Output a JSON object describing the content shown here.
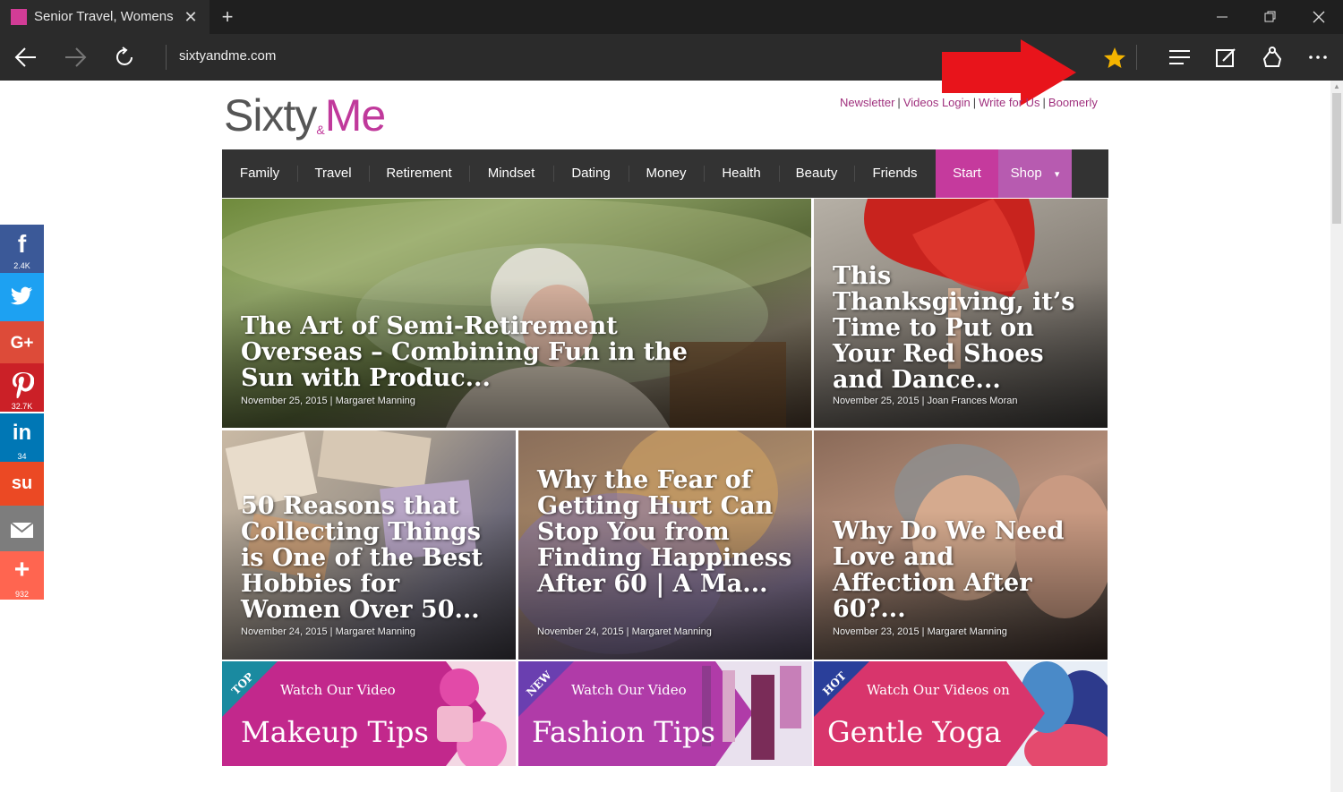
{
  "browser": {
    "tab_title": "Senior Travel, Womens I",
    "close_glyph": "✕",
    "new_tab_glyph": "+",
    "url": "sixtyandme.com"
  },
  "site": {
    "logo_sixty": "Sixty",
    "logo_amp": "&",
    "logo_me": "Me",
    "brand_color": "#c0399b",
    "toplinks": [
      "Newsletter",
      "Videos Login",
      "Write for Us",
      "Boomerly"
    ],
    "toplink_separator": "|"
  },
  "nav": {
    "items": [
      "Family",
      "Travel",
      "Retirement",
      "Mindset",
      "Dating",
      "Money",
      "Health",
      "Beauty",
      "Friends"
    ],
    "start": "Start",
    "shop": "Shop",
    "shop_caret": "▾"
  },
  "social": [
    {
      "icon": "facebook-icon",
      "glyph": "f",
      "count": "2.4K",
      "color": "#3b5998"
    },
    {
      "icon": "twitter-icon",
      "glyph": "🐦",
      "count": "",
      "color": "#1da1f2"
    },
    {
      "icon": "google-plus-icon",
      "glyph": "G+",
      "count": "",
      "color": "#dd4b39"
    },
    {
      "icon": "pinterest-icon",
      "glyph": "P",
      "count": "32.7K",
      "color": "#cb2027"
    },
    {
      "icon": "linkedin-icon",
      "glyph": "in",
      "count": "34",
      "color": "#0077b5"
    },
    {
      "icon": "stumbleupon-icon",
      "glyph": "su",
      "count": "",
      "color": "#eb4924"
    },
    {
      "icon": "email-icon",
      "glyph": "✉",
      "count": "",
      "color": "#7d7d7d"
    },
    {
      "icon": "share-plus-icon",
      "glyph": "+",
      "count": "932",
      "color": "#ff6550"
    }
  ],
  "articles": [
    {
      "title": "The Art of Semi-Retirement Overseas – Combining Fun in the Sun with Produc...",
      "date": "November 25, 2015",
      "author": "Margaret Manning",
      "meta": "November 25, 2015 | Margaret Manning"
    },
    {
      "title": "This Thanksgiving, it’s Time to Put on Your Red Shoes and Dance...",
      "date": "November 25, 2015",
      "author": "Joan Frances Moran",
      "meta": "November 25, 2015 | Joan Frances Moran"
    },
    {
      "title": "50 Reasons that Collecting Things is One of the Best Hobbies for Women Over 50...",
      "date": "November 24, 2015",
      "author": "Margaret Manning",
      "meta": "November 24, 2015 | Margaret Manning"
    },
    {
      "title": "Why the Fear of Getting Hurt Can Stop You from Finding Happiness After 60 | A Ma...",
      "date": "November 24, 2015",
      "author": "Margaret Manning",
      "meta": "November 24, 2015 | Margaret Manning"
    },
    {
      "title": "Why Do We Need Love and Affection After 60?...",
      "date": "November 23, 2015",
      "author": "Margaret Manning",
      "meta": "November 23, 2015 | Margaret Manning"
    }
  ],
  "promos": [
    {
      "badge": "TOP",
      "watch": "Watch Our Video",
      "title": "Makeup Tips",
      "color": "#c2288c",
      "badge_color": "#1a8aa0"
    },
    {
      "badge": "NEW",
      "watch": "Watch Our Video",
      "title": "Fashion Tips",
      "color": "#b03ba8",
      "badge_color": "#6a3fb0"
    },
    {
      "badge": "HOT",
      "watch": "Watch Our Videos on",
      "title": "Gentle Yoga",
      "color": "#d8356c",
      "badge_color": "#2a3f9a"
    }
  ]
}
